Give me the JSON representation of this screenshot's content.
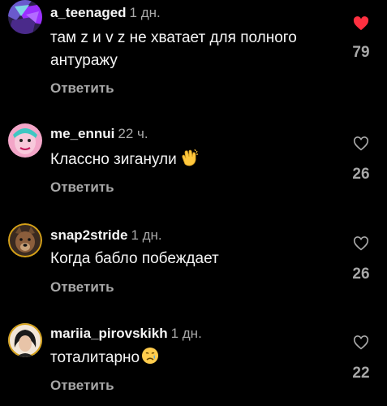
{
  "comments": [
    {
      "username": "a_teenaged",
      "time": "1 дн.",
      "text": "там z и v z не хватает для полного антуражу",
      "reply_label": "Ответить",
      "likes": "79",
      "liked": true,
      "avatar_icon": "purple-teal-abstract-avatar"
    },
    {
      "username": "me_ennui",
      "time": "22 ч.",
      "text": "Классно зиганули",
      "emoji": "clapping-hands-emoji",
      "reply_label": "Ответить",
      "likes": "26",
      "liked": false,
      "avatar_icon": "pink-face-avatar"
    },
    {
      "username": "snap2stride",
      "time": "1 дн.",
      "text": "Когда бабло побеждает",
      "reply_label": "Ответить",
      "likes": "26",
      "liked": false,
      "avatar_icon": "dog-avatar"
    },
    {
      "username": "mariia_pirovskikh",
      "time": "1 дн.",
      "text": "тоталитарно",
      "emoji": "crying-face-emoji",
      "reply_label": "Ответить",
      "likes": "22",
      "liked": false,
      "avatar_icon": "dark-hair-portrait-avatar"
    }
  ],
  "colors": {
    "background": "#000000",
    "primary_text": "#f5f5f5",
    "secondary_text": "#a8a8a8",
    "liked_heart": "#ff3040"
  }
}
